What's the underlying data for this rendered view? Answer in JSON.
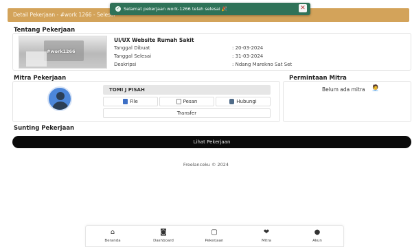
{
  "header": {
    "title": "Detail Pekerjaan - #work 1266 - Selesai"
  },
  "toast": {
    "icon": "check-circle-icon",
    "message": "Selamat pekerjaan work-1266 telah selesai 🎉",
    "close_label": "✕"
  },
  "about": {
    "section_title": "Tentang Pekerjaan",
    "thumbnail_text": "#work1266",
    "job_name": "UI/UX Website Rumah Sakit",
    "fields": [
      {
        "label": "Tanggal Dibuat",
        "value": ": 20-03-2024"
      },
      {
        "label": "Tanggal Selesai",
        "value": ": 31-03-2024"
      },
      {
        "label": "Deskripsi",
        "value": ": Ndang Marekno Sat Set"
      }
    ]
  },
  "mitra": {
    "section_title": "Mitra Pekerjaan",
    "name": "TOMI J PISAH",
    "buttons": {
      "file": "File",
      "pesan": "Pesan",
      "hubungi": "Hubungi",
      "transfer": "Transfer"
    }
  },
  "permintaan": {
    "section_title": "Permintaan Mitra",
    "empty_text": "Belum ada mitra",
    "empty_icon": "🧑‍💼"
  },
  "sunting": {
    "section_title": "Sunting Pekerjaan",
    "button_label": "Lihat Pekerjaan"
  },
  "footer": {
    "text": "Freelanceku © 2024"
  },
  "bottom_nav": [
    {
      "label": "Beranda",
      "icon": "home-icon",
      "glyph": "⌂"
    },
    {
      "label": "Dashboard",
      "icon": "dashboard-icon",
      "glyph": "◙"
    },
    {
      "label": "Pekerjaan",
      "icon": "briefcase-icon",
      "glyph": "▢"
    },
    {
      "label": "Mitra",
      "icon": "handshake-icon",
      "glyph": "❤"
    },
    {
      "label": "Akun",
      "icon": "account-icon",
      "glyph": "●"
    }
  ]
}
